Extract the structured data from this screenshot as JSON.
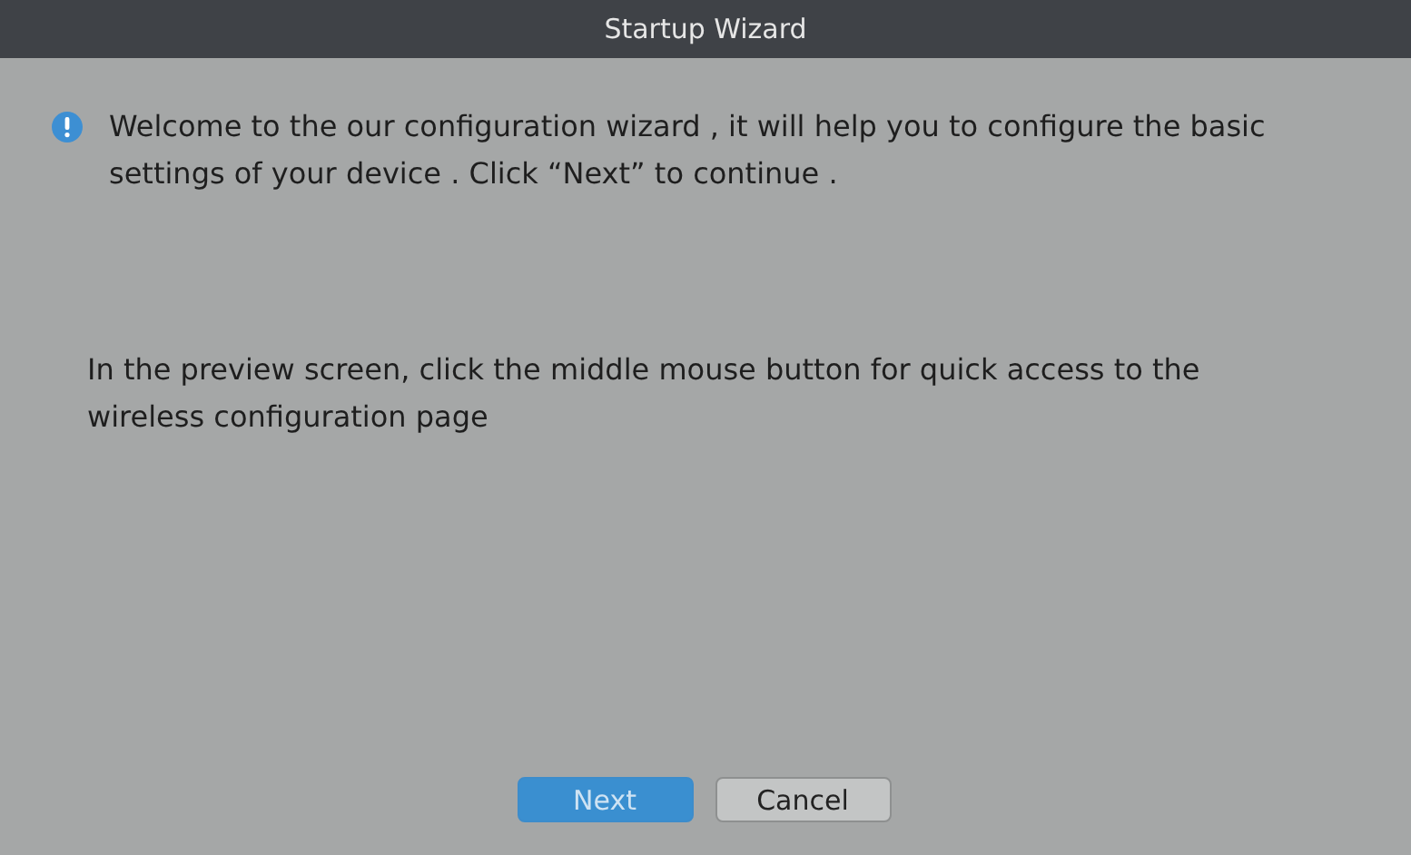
{
  "window": {
    "title": "Startup Wizard"
  },
  "notice": {
    "text": "Welcome to the our configuration wizard , it will help you to configure the basic settings of your device . Click “Next” to continue ."
  },
  "hint": "In the preview screen, click the middle mouse button for quick access to the wireless configuration page",
  "buttons": [
    {
      "label": "Next",
      "kind": "primary"
    },
    {
      "label": "Cancel",
      "kind": "default"
    }
  ]
}
